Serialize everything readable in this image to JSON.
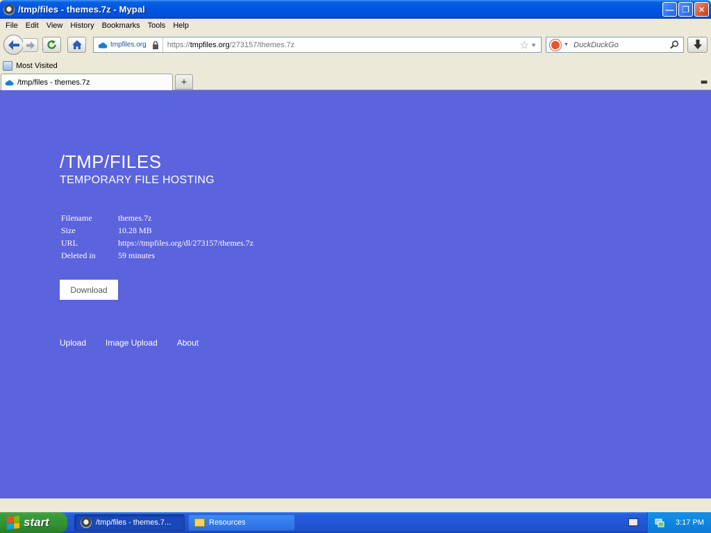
{
  "window": {
    "title": "/tmp/files - themes.7z - Mypal"
  },
  "menu": [
    "File",
    "Edit",
    "View",
    "History",
    "Bookmarks",
    "Tools",
    "Help"
  ],
  "navbar": {
    "identity_host": "tmpfiles.org",
    "url_prefix": "https://",
    "url_host": "tmpfiles.org",
    "url_path": "/273157/themes.7z",
    "search_placeholder": "DuckDuckGo"
  },
  "bookmarks": {
    "most_visited": "Most Visited"
  },
  "tab": {
    "label": "/tmp/files - themes.7z"
  },
  "page": {
    "title": "/TMP/FILES",
    "subtitle": "TEMPORARY FILE HOSTING",
    "info": [
      {
        "key": "Filename",
        "value": "themes.7z"
      },
      {
        "key": "Size",
        "value": "10.28 MB"
      },
      {
        "key": "URL",
        "value": "https://tmpfiles.org/dl/273157/themes.7z"
      },
      {
        "key": "Deleted in",
        "value": "59 minutes"
      }
    ],
    "download_label": "Download",
    "footer_links": [
      "Upload",
      "Image Upload",
      "About"
    ],
    "background_color": "#5b63dd"
  },
  "taskbar": {
    "start_label": "start",
    "tasks": [
      {
        "label": "/tmp/files - themes.7..."
      },
      {
        "label": "Resources"
      }
    ],
    "clock": "3:17 PM"
  }
}
